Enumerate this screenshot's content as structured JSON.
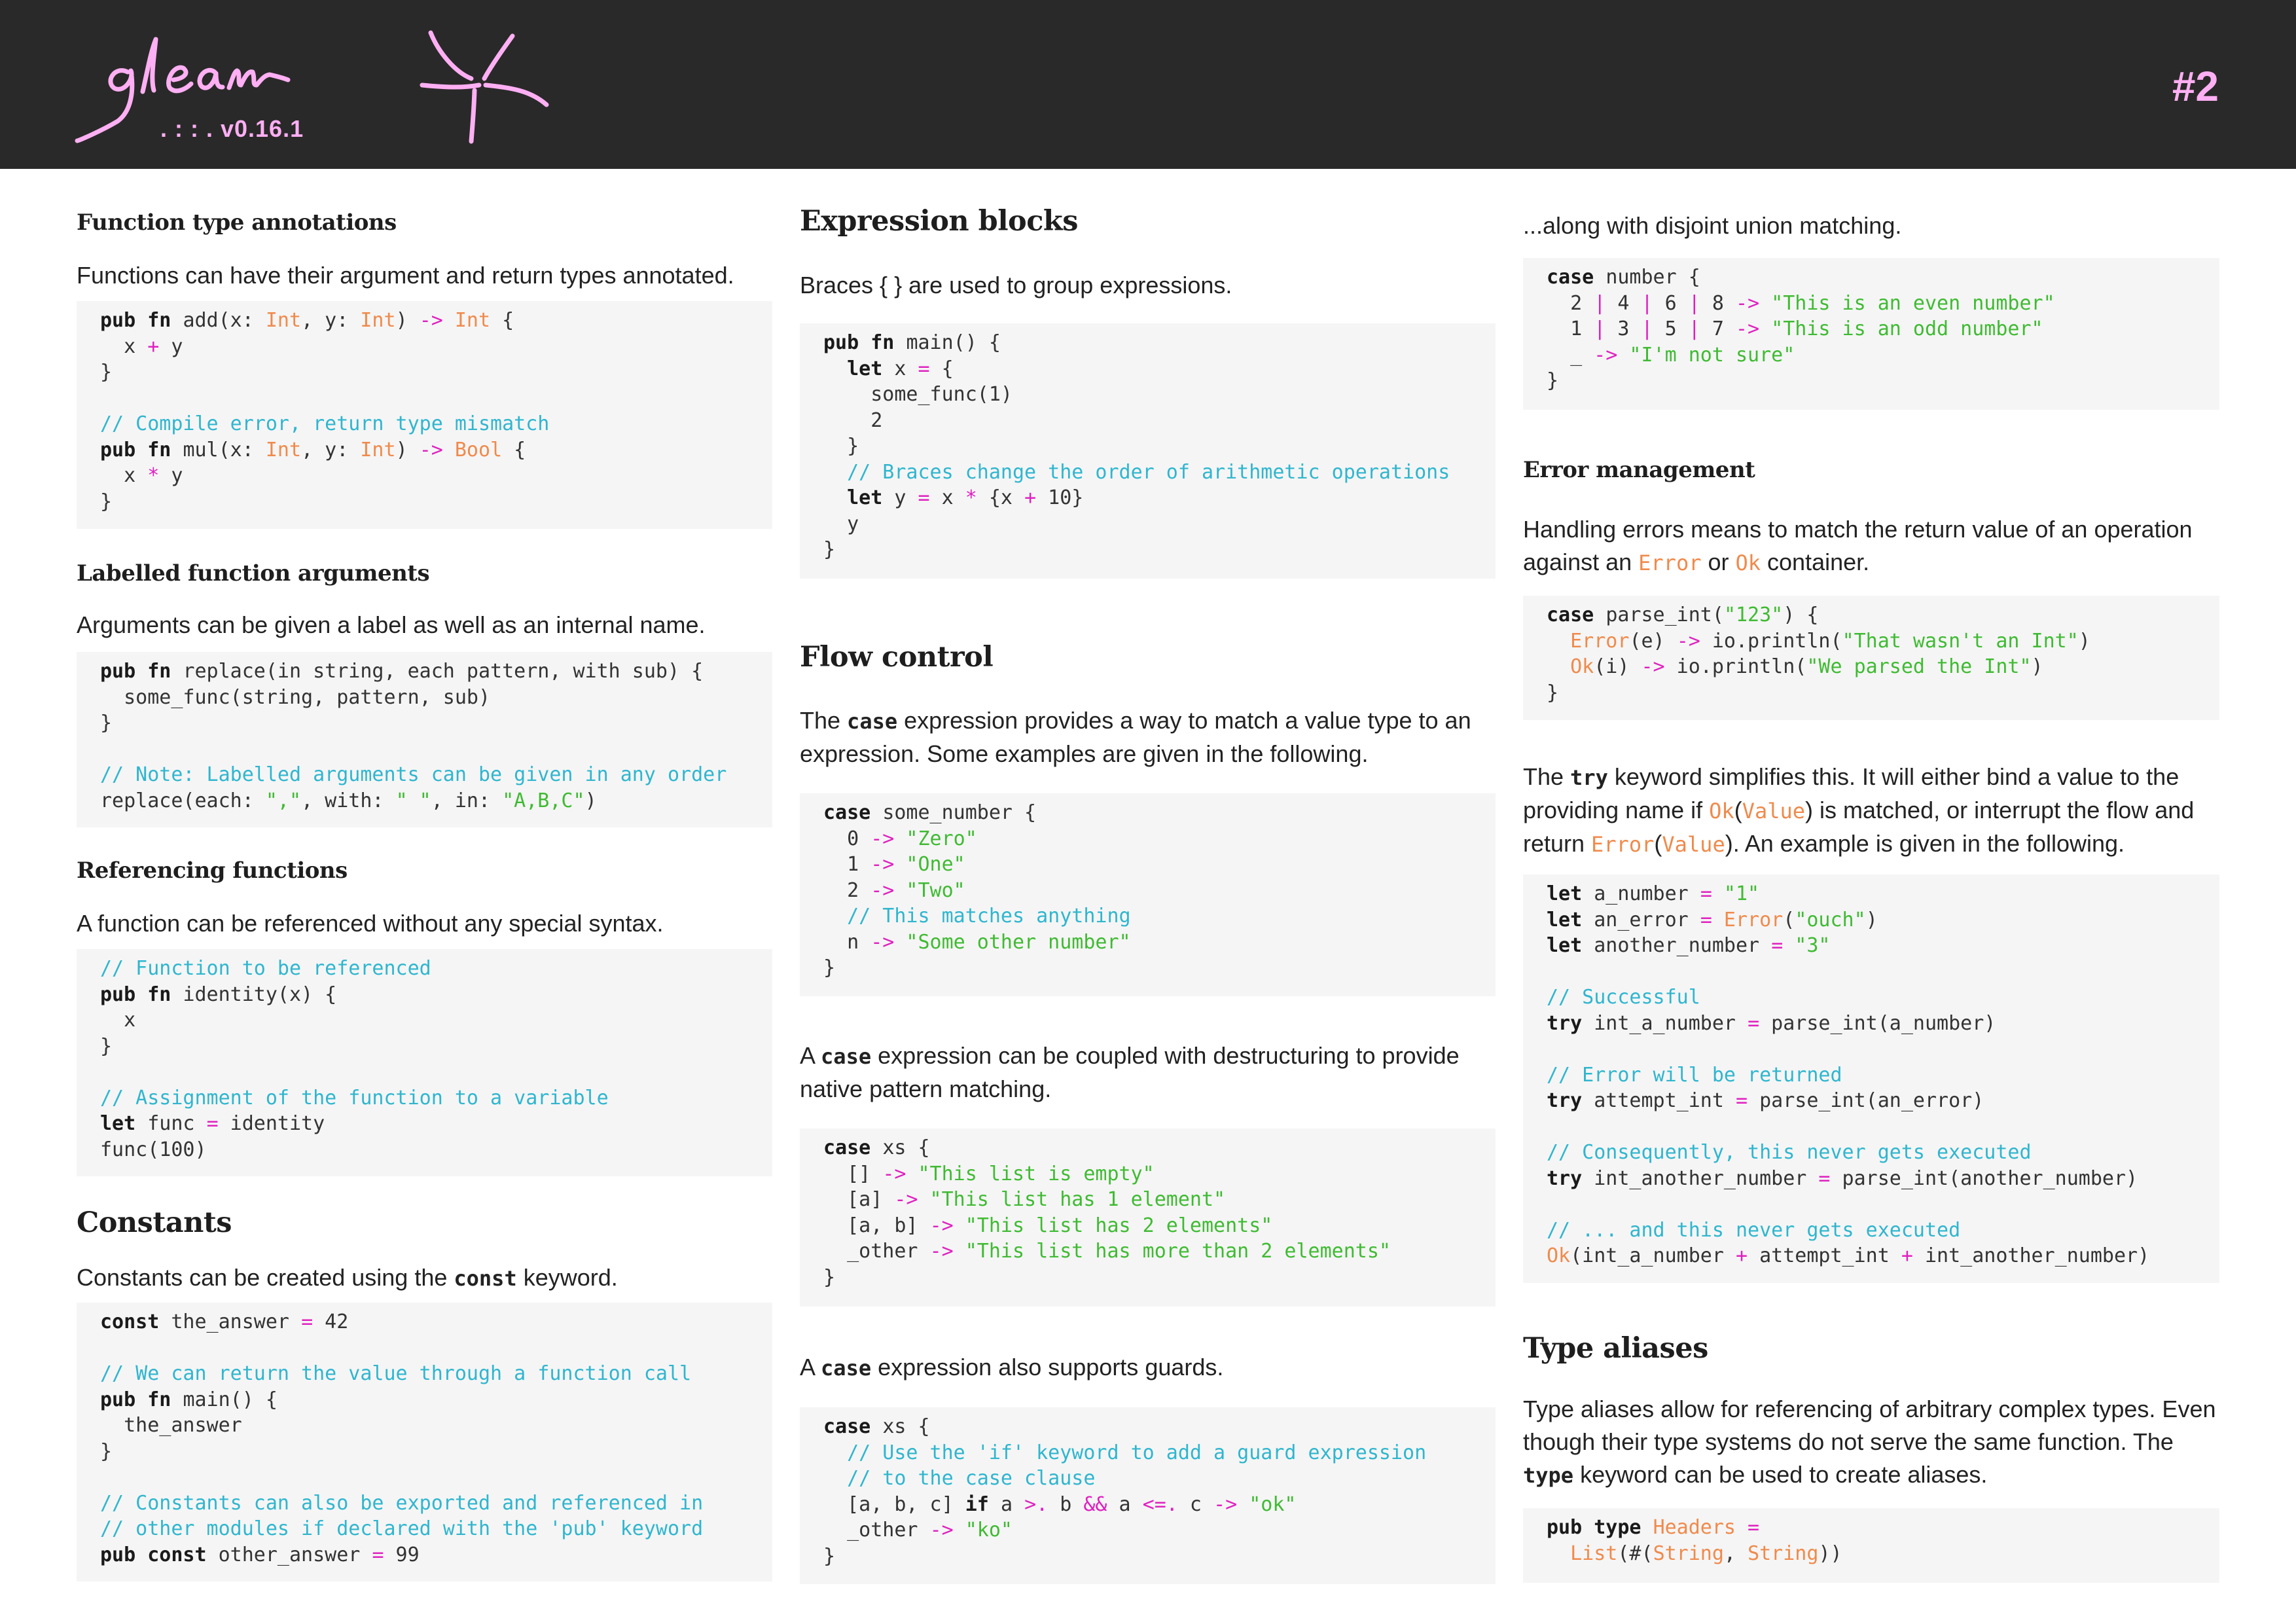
{
  "header": {
    "brand": "gleam",
    "version": ". : : .  v0.16.1",
    "page_number": "#2",
    "colors": {
      "background": "#292929",
      "accent": "#ffaff3"
    }
  },
  "colors": {
    "keyword": "#1a1a1a",
    "type": "#f08a4b",
    "operator": "#e020c0",
    "string": "#3fbb32",
    "comment": "#2fb6cf",
    "code_background": "#f5f5f5"
  },
  "col1": {
    "fta": {
      "title": "Function type annotations",
      "text": "Functions can have their argument and return types annotated."
    },
    "lfa": {
      "title": "Labelled function arguments",
      "text": "Arguments can be given a label as well as an internal name."
    },
    "ref": {
      "title": "Referencing functions",
      "text": "A function can be referenced without any special syntax."
    },
    "const": {
      "title": "Constants",
      "text_before": "Constants can be created using the ",
      "text_code": "const",
      "text_after": " keyword."
    }
  },
  "col2": {
    "expr": {
      "title": "Expression blocks",
      "text": "Braces { } are used to group expressions."
    },
    "flow": {
      "title": "Flow control",
      "p1_before": "The ",
      "p1_code": "case",
      "p1_after": " expression provides a way to match a value type to an expression. Some examples are given in the following.",
      "p2_before": "A ",
      "p2_code": "case",
      "p2_after": " expression can be coupled with destructuring to provide native pattern matching.",
      "p3_before": "A ",
      "p3_code": "case",
      "p3_after": " expression also supports guards."
    }
  },
  "col3": {
    "union": {
      "text": "...along with disjoint union matching."
    },
    "err": {
      "title": "Error management",
      "text_a": "Handling errors means to match the return value of an operation against an ",
      "error_word": "Error",
      "text_b": " or ",
      "ok_word": "Ok",
      "text_c": " container."
    },
    "try": {
      "a": "The ",
      "code": "try",
      "b": " keyword simplifies this.  It will either bind a value to the providing name if ",
      "ok": "Ok",
      "lp1": "(",
      "value1": "Value",
      "rp1": ")",
      "c": " is matched, or interrupt the flow and return ",
      "error": "Error",
      "lp2": "(",
      "value2": "Value",
      "rp2": ")",
      "d": ". An example is given in the following."
    },
    "alias": {
      "title": "Type aliases",
      "text_before": "Type aliases allow for referencing of arbitrary complex types. Even though their type systems do not serve the same function.  The ",
      "text_code": "type",
      "text_after": " keyword can be used to create aliases."
    }
  },
  "code": {
    "fta": [
      [
        [
          "k",
          "pub fn"
        ],
        [
          "",
          "add(x: "
        ],
        [
          "t",
          "Int"
        ],
        [
          "",
          ", y: "
        ],
        [
          "t",
          "Int"
        ],
        [
          "",
          ") "
        ],
        [
          "o",
          "->"
        ],
        [
          "t",
          " Int"
        ],
        [
          "",
          " {"
        ]
      ],
      [
        [
          "",
          "  x "
        ],
        [
          "o",
          "+"
        ],
        [
          "",
          " y"
        ]
      ],
      [
        [
          "",
          "}"
        ]
      ],
      [],
      [
        [
          "c",
          "// Compile error, return type mismatch"
        ]
      ],
      [
        [
          "k",
          "pub fn"
        ],
        [
          "",
          "mul(x: "
        ],
        [
          "t",
          "Int"
        ],
        [
          "",
          ", y: "
        ],
        [
          "t",
          "Int"
        ],
        [
          "",
          ") "
        ],
        [
          "o",
          "->"
        ],
        [
          "t",
          " Bool"
        ],
        [
          "",
          " {"
        ]
      ],
      [
        [
          "",
          "  x "
        ],
        [
          "o",
          "*"
        ],
        [
          "",
          " y"
        ]
      ],
      [
        [
          "",
          "}"
        ]
      ]
    ],
    "lfa": [
      [
        [
          "k",
          "pub fn"
        ],
        [
          "",
          "replace(in string, each pattern, with sub) {"
        ]
      ],
      [
        [
          "",
          "  some_func(string, pattern, sub)"
        ]
      ],
      [
        [
          "",
          "}"
        ]
      ],
      [],
      [
        [
          "c",
          "// Note: Labelled arguments can be given in any order"
        ]
      ],
      [
        [
          "",
          "replace(each: "
        ],
        [
          "s",
          "\",\""
        ],
        [
          "",
          ", with: "
        ],
        [
          "s",
          "\" \""
        ],
        [
          "",
          ", in: "
        ],
        [
          "s",
          "\"A,B,C\""
        ],
        [
          "",
          ")"
        ]
      ]
    ],
    "ref": [
      [
        [
          "c",
          "// Function to be referenced"
        ]
      ],
      [
        [
          "k",
          "pub fn"
        ],
        [
          "",
          "identity(x) {"
        ]
      ],
      [
        [
          "",
          "  x"
        ]
      ],
      [
        [
          "",
          "}"
        ]
      ],
      [],
      [
        [
          "c",
          "// Assignment of the function to a variable"
        ]
      ],
      [
        [
          "k",
          "let"
        ],
        [
          "",
          "func "
        ],
        [
          "o",
          "="
        ],
        [
          "",
          " identity"
        ]
      ],
      [
        [
          "",
          "func(100)"
        ]
      ]
    ],
    "const": [
      [
        [
          "k",
          "const"
        ],
        [
          "",
          "the_answer "
        ],
        [
          "o",
          "="
        ],
        [
          "",
          " 42"
        ]
      ],
      [],
      [
        [
          "c",
          "// We can return the value through a function call"
        ]
      ],
      [
        [
          "k",
          "pub fn"
        ],
        [
          "",
          "main() {"
        ]
      ],
      [
        [
          "",
          "  the_answer"
        ]
      ],
      [
        [
          "",
          "}"
        ]
      ],
      [],
      [
        [
          "c",
          "// Constants can also be exported and referenced in"
        ]
      ],
      [
        [
          "c",
          "// other modules if declared with the 'pub' keyword"
        ]
      ],
      [
        [
          "k",
          "pub const"
        ],
        [
          "",
          "other_answer "
        ],
        [
          "o",
          "="
        ],
        [
          "",
          " 99"
        ]
      ]
    ],
    "expr": [
      [
        [
          "k",
          "pub fn"
        ],
        [
          "",
          "main() {"
        ]
      ],
      [
        [
          "",
          "  "
        ],
        [
          "k",
          "let"
        ],
        [
          "",
          "x "
        ],
        [
          "o",
          "="
        ],
        [
          "",
          " {"
        ]
      ],
      [
        [
          "",
          "    some_func(1)"
        ]
      ],
      [
        [
          "",
          "    2"
        ]
      ],
      [
        [
          "",
          "  }"
        ]
      ],
      [
        [
          "",
          "  "
        ],
        [
          "c",
          "// Braces change the order of arithmetic operations"
        ]
      ],
      [
        [
          "",
          "  "
        ],
        [
          "k",
          "let"
        ],
        [
          "",
          "y "
        ],
        [
          "o",
          "="
        ],
        [
          "",
          " x "
        ],
        [
          "o",
          "*"
        ],
        [
          "",
          " {x "
        ],
        [
          "o",
          "+"
        ],
        [
          "",
          " 10}"
        ]
      ],
      [
        [
          "",
          "  y"
        ]
      ],
      [
        [
          "",
          "}"
        ]
      ]
    ],
    "case1": [
      [
        [
          "k",
          "case"
        ],
        [
          "",
          "some_number {"
        ]
      ],
      [
        [
          "",
          "  0 "
        ],
        [
          "o",
          "->"
        ],
        [
          "s",
          " \"Zero\""
        ]
      ],
      [
        [
          "",
          "  1 "
        ],
        [
          "o",
          "->"
        ],
        [
          "s",
          " \"One\""
        ]
      ],
      [
        [
          "",
          "  2 "
        ],
        [
          "o",
          "->"
        ],
        [
          "s",
          " \"Two\""
        ]
      ],
      [
        [
          "",
          "  "
        ],
        [
          "c",
          "// This matches anything"
        ]
      ],
      [
        [
          "",
          "  n "
        ],
        [
          "o",
          "->"
        ],
        [
          "s",
          " \"Some other number\""
        ]
      ],
      [
        [
          "",
          "}"
        ]
      ]
    ],
    "case2": [
      [
        [
          "k",
          "case"
        ],
        [
          "",
          "xs {"
        ]
      ],
      [
        [
          "",
          "  [] "
        ],
        [
          "o",
          "->"
        ],
        [
          "s",
          " \"This list is empty\""
        ]
      ],
      [
        [
          "",
          "  [a] "
        ],
        [
          "o",
          "->"
        ],
        [
          "s",
          " \"This list has 1 element\""
        ]
      ],
      [
        [
          "",
          "  [a, b] "
        ],
        [
          "o",
          "->"
        ],
        [
          "s",
          " \"This list has 2 elements\""
        ]
      ],
      [
        [
          "",
          "  _other "
        ],
        [
          "o",
          "->"
        ],
        [
          "s",
          " \"This list has more than 2 elements\""
        ]
      ],
      [
        [
          "",
          "}"
        ]
      ]
    ],
    "case3": [
      [
        [
          "k",
          "case"
        ],
        [
          "",
          "xs {"
        ]
      ],
      [
        [
          "",
          "  "
        ],
        [
          "c",
          "// Use the 'if' keyword to add a guard expression"
        ]
      ],
      [
        [
          "",
          "  "
        ],
        [
          "c",
          "// to the case clause"
        ]
      ],
      [
        [
          "",
          "  [a, b, c] "
        ],
        [
          "k",
          "if"
        ],
        [
          "",
          "a "
        ],
        [
          "o",
          ">."
        ],
        [
          "",
          " b "
        ],
        [
          "o",
          "&&"
        ],
        [
          "",
          " a "
        ],
        [
          "o",
          "<=."
        ],
        [
          "",
          " c "
        ],
        [
          "o",
          "->"
        ],
        [
          "s",
          " \"ok\""
        ]
      ],
      [
        [
          "",
          "  _other "
        ],
        [
          "o",
          "->"
        ],
        [
          "s",
          " \"ko\""
        ]
      ],
      [
        [
          "",
          "}"
        ]
      ]
    ],
    "union": [
      [
        [
          "k",
          "case"
        ],
        [
          "",
          "number {"
        ]
      ],
      [
        [
          "",
          "  2 "
        ],
        [
          "o",
          "|"
        ],
        [
          "",
          " 4 "
        ],
        [
          "o",
          "|"
        ],
        [
          "",
          " 6 "
        ],
        [
          "o",
          "|"
        ],
        [
          "",
          " 8 "
        ],
        [
          "o",
          "->"
        ],
        [
          "s",
          " \"This is an even number\""
        ]
      ],
      [
        [
          "",
          "  1 "
        ],
        [
          "o",
          "|"
        ],
        [
          "",
          " 3 "
        ],
        [
          "o",
          "|"
        ],
        [
          "",
          " 5 "
        ],
        [
          "o",
          "|"
        ],
        [
          "",
          " 7 "
        ],
        [
          "o",
          "->"
        ],
        [
          "s",
          " \"This is an odd number\""
        ]
      ],
      [
        [
          "",
          "  _ "
        ],
        [
          "o",
          "->"
        ],
        [
          "s",
          " \"I'm not sure\""
        ]
      ],
      [
        [
          "",
          "}"
        ]
      ]
    ],
    "err": [
      [
        [
          "k",
          "case"
        ],
        [
          "",
          "parse_int("
        ],
        [
          "s",
          "\"123\""
        ],
        [
          "",
          ") {"
        ]
      ],
      [
        [
          "",
          "  "
        ],
        [
          "t",
          "Error"
        ],
        [
          "",
          "(e) "
        ],
        [
          "o",
          "->"
        ],
        [
          "",
          " io.println("
        ],
        [
          "s",
          "\"That wasn't an Int\""
        ],
        [
          "",
          ")"
        ]
      ],
      [
        [
          "",
          "  "
        ],
        [
          "t",
          "Ok"
        ],
        [
          "",
          "(i) "
        ],
        [
          "o",
          "->"
        ],
        [
          "",
          " io.println("
        ],
        [
          "s",
          "\"We parsed the Int\""
        ],
        [
          "",
          ")"
        ]
      ],
      [
        [
          "",
          "}"
        ]
      ]
    ],
    "try": [
      [
        [
          "k",
          "let"
        ],
        [
          "",
          "a_number "
        ],
        [
          "o",
          "="
        ],
        [
          "s",
          " \"1\""
        ]
      ],
      [
        [
          "k",
          "let"
        ],
        [
          "",
          "an_error "
        ],
        [
          "o",
          "="
        ],
        [
          "t",
          " Error"
        ],
        [
          "",
          "("
        ],
        [
          "s",
          "\"ouch\""
        ],
        [
          "",
          ")"
        ]
      ],
      [
        [
          "k",
          "let"
        ],
        [
          "",
          "another_number "
        ],
        [
          "o",
          "="
        ],
        [
          "s",
          " \"3\""
        ]
      ],
      [],
      [
        [
          "c",
          "// Successful"
        ]
      ],
      [
        [
          "k",
          "try"
        ],
        [
          "",
          "int_a_number "
        ],
        [
          "o",
          "="
        ],
        [
          "",
          " parse_int(a_number)"
        ]
      ],
      [],
      [
        [
          "c",
          "// Error will be returned"
        ]
      ],
      [
        [
          "k",
          "try"
        ],
        [
          "",
          "attempt_int "
        ],
        [
          "o",
          "="
        ],
        [
          "",
          " parse_int(an_error)"
        ]
      ],
      [],
      [
        [
          "c",
          "// Consequently, this never gets executed"
        ]
      ],
      [
        [
          "k",
          "try"
        ],
        [
          "",
          "int_another_number "
        ],
        [
          "o",
          "="
        ],
        [
          "",
          " parse_int(another_number)"
        ]
      ],
      [],
      [
        [
          "c",
          "// ... and this never gets executed"
        ]
      ],
      [
        [
          "t",
          "Ok"
        ],
        [
          "",
          "(int_a_number "
        ],
        [
          "o",
          "+"
        ],
        [
          "",
          " attempt_int "
        ],
        [
          "o",
          "+"
        ],
        [
          "",
          " int_another_number)"
        ]
      ]
    ],
    "alias": [
      [
        [
          "k",
          "pub type"
        ],
        [
          "t",
          "Headers"
        ],
        [
          "o",
          " ="
        ]
      ],
      [
        [
          "",
          "  "
        ],
        [
          "t",
          "List"
        ],
        [
          "",
          "(#("
        ],
        [
          "t",
          "String"
        ],
        [
          "",
          ", "
        ],
        [
          "t",
          "String"
        ],
        [
          "",
          "))"
        ]
      ]
    ]
  }
}
